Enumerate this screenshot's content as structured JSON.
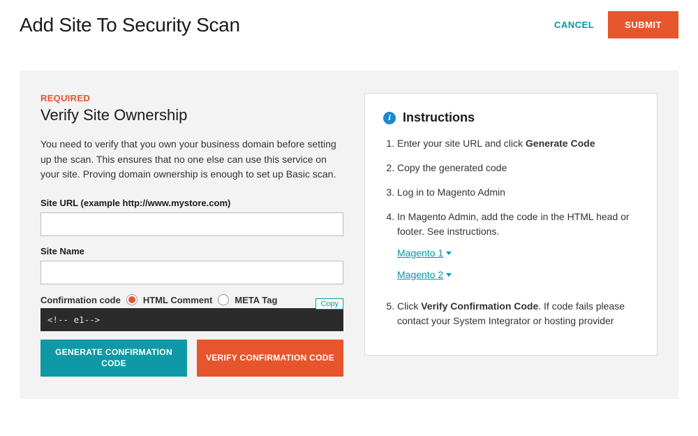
{
  "header": {
    "title": "Add Site To Security Scan",
    "cancel": "CANCEL",
    "submit": "SUBMIT"
  },
  "form": {
    "required_label": "REQUIRED",
    "section_title": "Verify Site Ownership",
    "description": "You need to verify that you own your business domain before setting up the scan. This ensures that no one else can use this service on your site. Proving domain ownership is enough to set up Basic scan.",
    "site_url_label": "Site URL (example http://www.mystore.com)",
    "site_url_value": "",
    "site_name_label": "Site Name",
    "site_name_value": "",
    "confirmation_code_label": "Confirmation code",
    "radio_html_comment": "HTML Comment",
    "radio_meta_tag": "META Tag",
    "radio_selected": "html_comment",
    "copy_label": "Copy",
    "code_value": "<!--                                                    e1-->",
    "generate_btn": "GENERATE CONFIRMATION CODE",
    "verify_btn": "VERIFY CONFIRMATION CODE"
  },
  "instructions": {
    "title": "Instructions",
    "step1_prefix": "Enter your site URL and click ",
    "step1_strong": "Generate Code",
    "step2": "Copy the generated code",
    "step3": "Log in to Magento Admin",
    "step4": "In Magento Admin, add the code in the HTML head or footer. See instructions.",
    "magento1_link": "Magento 1",
    "magento2_link": "Magento 2",
    "step5_prefix": "Click ",
    "step5_strong": "Verify Confirmation Code",
    "step5_suffix": ". If code fails please contact your System Integrator or hosting provider"
  }
}
